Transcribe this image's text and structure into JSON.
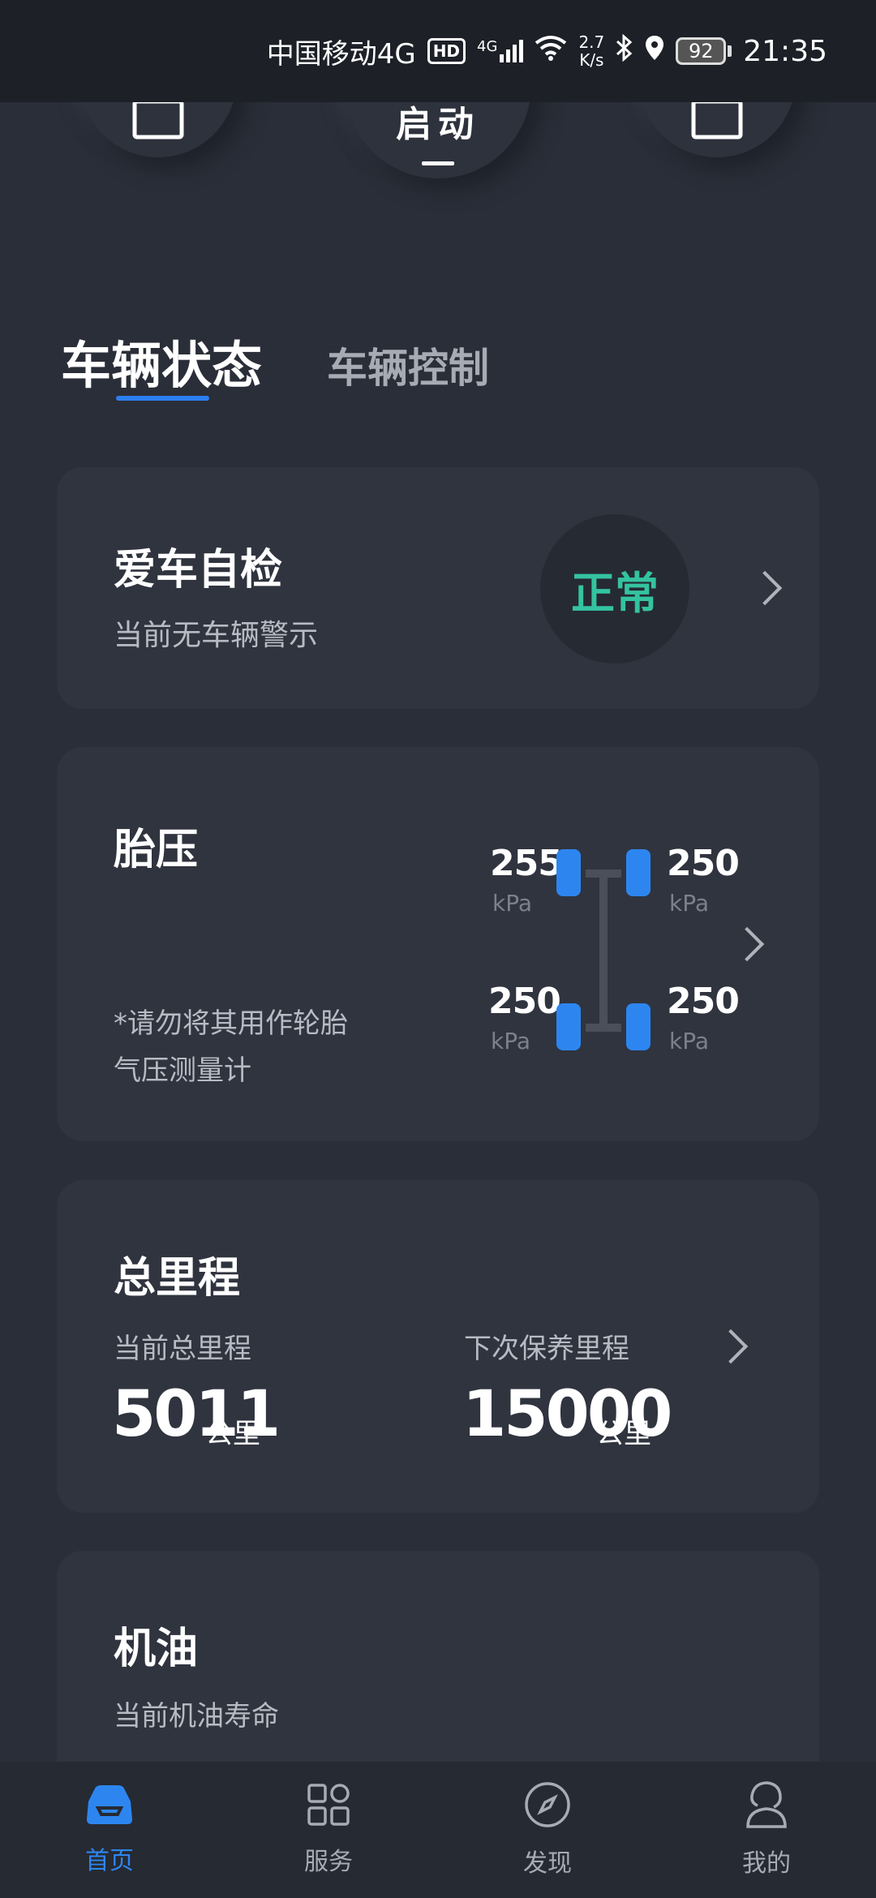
{
  "status_bar": {
    "carrier": "中国移动4G",
    "hd": "HD",
    "network": "4G",
    "speed_value": "2.7",
    "speed_unit": "K/s",
    "battery": "92",
    "time": "21:35"
  },
  "controls": {
    "start_label": "启动"
  },
  "tabs": {
    "active": "车辆状态",
    "inactive": "车辆控制"
  },
  "self_check": {
    "title": "爱车自检",
    "subtitle": "当前无车辆警示",
    "status": "正常"
  },
  "tire": {
    "title": "胎压",
    "note": "*请勿将其用作轮胎气压测量计",
    "front_left": "255",
    "front_right": "250",
    "rear_left": "250",
    "rear_right": "250",
    "unit": "kPa"
  },
  "odometer": {
    "title": "总里程",
    "current_label": "当前总里程",
    "current_value": "5011",
    "next_label": "下次保养里程",
    "next_value": "15000",
    "unit": "公里"
  },
  "oil": {
    "title": "机油",
    "subtitle": "当前机油寿命"
  },
  "nav": {
    "home": "首页",
    "service": "服务",
    "discover": "发现",
    "mine": "我的"
  },
  "colors": {
    "accent": "#2d86f0",
    "status_ok": "#34c3a0",
    "card_bg": "#30343f",
    "page_bg": "#2a2e38"
  }
}
